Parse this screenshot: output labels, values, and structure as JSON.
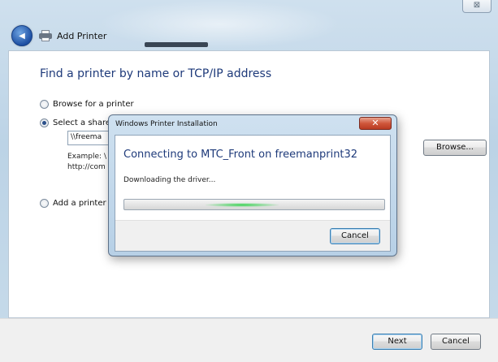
{
  "window": {
    "close_glyph": "⊠"
  },
  "header": {
    "back_glyph": "◀",
    "title": "Add Printer"
  },
  "main": {
    "heading": "Find a printer by name or TCP/IP address",
    "options": [
      {
        "label": "Browse for a printer",
        "checked": false
      },
      {
        "label": "Select a share",
        "checked": true
      },
      {
        "label": "Add a printer",
        "checked": false
      }
    ],
    "share_value": "\\\\freema",
    "example_line1": "Example: \\",
    "example_line2": "http://com",
    "browse_label": "Browse..."
  },
  "footer": {
    "next_label": "Next",
    "cancel_label": "Cancel"
  },
  "dialog": {
    "title": "Windows Printer Installation",
    "close_glyph": "✕",
    "heading": "Connecting to MTC_Front on freemanprint32",
    "status": "Downloading the driver...",
    "progress_percent": 45,
    "cancel_label": "Cancel"
  },
  "colors": {
    "heading_blue": "#1e3a7a",
    "progress_green": "#2fd24a",
    "close_red": "#d0573c"
  }
}
